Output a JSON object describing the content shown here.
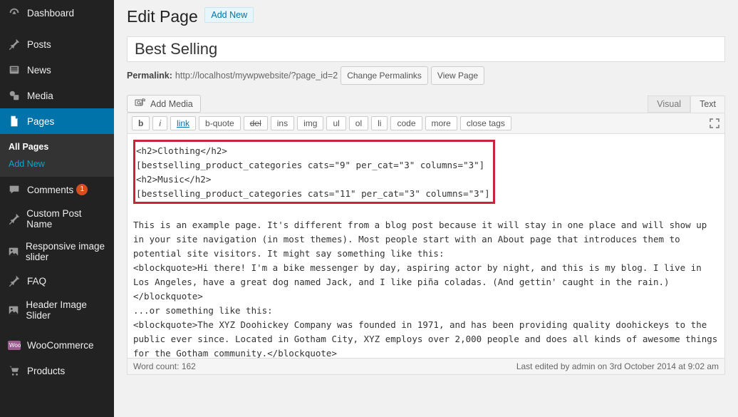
{
  "sidebar": {
    "items": [
      {
        "label": "Dashboard",
        "name": "sidebar-item-dashboard"
      },
      {
        "label": "Posts",
        "name": "sidebar-item-posts"
      },
      {
        "label": "News",
        "name": "sidebar-item-news"
      },
      {
        "label": "Media",
        "name": "sidebar-item-media"
      },
      {
        "label": "Pages",
        "name": "sidebar-item-pages",
        "active": true
      },
      {
        "label": "Comments",
        "name": "sidebar-item-comments",
        "badge": "1"
      },
      {
        "label": "Custom Post Name",
        "name": "sidebar-item-cpt"
      },
      {
        "label": "Responsive image slider",
        "name": "sidebar-item-rislider"
      },
      {
        "label": "FAQ",
        "name": "sidebar-item-faq"
      },
      {
        "label": "Header Image Slider",
        "name": "sidebar-item-hislider"
      },
      {
        "label": "WooCommerce",
        "name": "sidebar-item-woocommerce"
      },
      {
        "label": "Products",
        "name": "sidebar-item-products"
      }
    ],
    "sub": {
      "all": "All Pages",
      "addnew": "Add New"
    }
  },
  "header": {
    "title": "Edit Page",
    "addnew": "Add New"
  },
  "post_title": "Best Selling",
  "permalink": {
    "label": "Permalink:",
    "url": "http://localhost/mywpwebsite/?page_id=2",
    "change": "Change Permalinks",
    "view": "View Page"
  },
  "media": {
    "add_media": "Add Media"
  },
  "editor_tabs": {
    "visual": "Visual",
    "text": "Text"
  },
  "quicktags": {
    "b": "b",
    "i": "i",
    "link": "link",
    "bquote": "b-quote",
    "del": "del",
    "ins": "ins",
    "img": "img",
    "ul": "ul",
    "ol": "ol",
    "li": "li",
    "code": "code",
    "more": "more",
    "close": "close tags"
  },
  "content": {
    "highlight": "<h2>Clothing</h2>\n[bestselling_product_categories cats=\"9\" per_cat=\"3\" columns=\"3\"]\n<h2>Music</h2>\n[bestselling_product_categories cats=\"11\" per_cat=\"3\" columns=\"3\"]",
    "rest": "This is an example page. It's different from a blog post because it will stay in one place and will show up in your site navigation (in most themes). Most people start with an About page that introduces them to potential site visitors. It might say something like this:\n<blockquote>Hi there! I'm a bike messenger by day, aspiring actor by night, and this is my blog. I live in Los Angeles, have a great dog named Jack, and I like piña coladas. (And gettin' caught in the rain.)</blockquote>\n...or something like this:\n<blockquote>The XYZ Doohickey Company was founded in 1971, and has been providing quality doohickeys to the public ever since. Located in Gotham City, XYZ employs over 2,000 people and does all kinds of awesome things for the Gotham community.</blockquote>\nAs a new WordPress user, you should go to <a href=\"http://localhost/mywpwebsite/wp-admin/\">your dashboard</a> to delete this page and create new pages for your content. Have fun!"
  },
  "status": {
    "wordcount_label": "Word count: ",
    "wordcount": "162",
    "lastedit": "Last edited by admin on 3rd October 2014 at 9:02 am"
  }
}
